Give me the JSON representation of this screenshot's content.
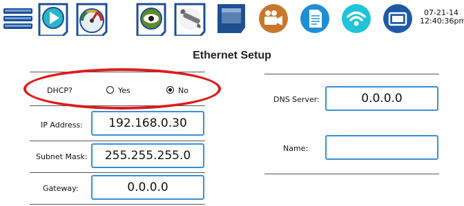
{
  "toolbar": {
    "buttons": [
      {
        "icon": "menu-stack-icon"
      },
      {
        "icon": "play-icon"
      },
      {
        "icon": "gauge-icon"
      },
      {
        "icon": "eye-icon"
      },
      {
        "icon": "wrench-icon"
      },
      {
        "icon": "display-icon"
      },
      {
        "icon": "video-camera-icon"
      },
      {
        "icon": "document-icon"
      },
      {
        "icon": "wifi-icon"
      },
      {
        "icon": "screen-icon"
      }
    ],
    "date": "07-21-14",
    "time": "12:40:36pm"
  },
  "page": {
    "title": "Ethernet Setup"
  },
  "dhcp": {
    "label": "DHCP?",
    "options": [
      {
        "label": "Yes",
        "selected": false
      },
      {
        "label": "No",
        "selected": true
      }
    ]
  },
  "fields": {
    "ip": {
      "label": "IP Address:",
      "value": "192.168.0.30"
    },
    "subnet": {
      "label": "Subnet Mask:",
      "value": "255.255.255.0"
    },
    "gateway": {
      "label": "Gateway:",
      "value": "0.0.0.0"
    },
    "dns": {
      "label": "DNS Server:",
      "value": "0.0.0.0"
    },
    "name": {
      "label": "Name:",
      "value": ""
    }
  },
  "colors": {
    "field_border": "#3a8fd6",
    "highlight_oval": "#e01b1b"
  }
}
